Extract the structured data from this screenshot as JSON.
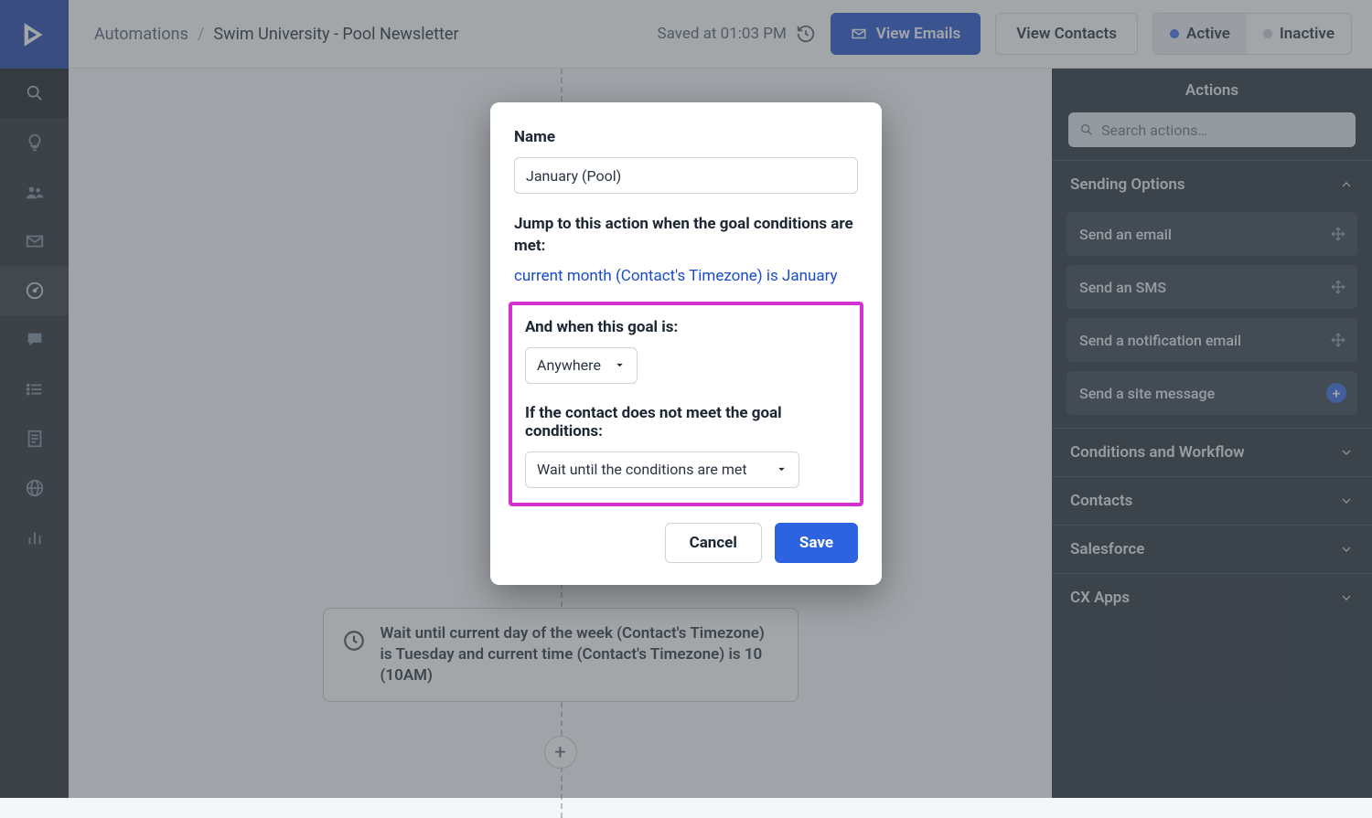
{
  "header": {
    "breadcrumb_root": "Automations",
    "breadcrumb_current": "Swim University - Pool Newsletter",
    "saved_text": "Saved at 01:03 PM",
    "view_emails": "View Emails",
    "view_contacts": "View Contacts",
    "toggle_active": "Active",
    "toggle_inactive": "Inactive"
  },
  "canvas": {
    "wait_text": "Wait until current day of the week (Contact's Timezone) is Tuesday and current time (Contact's Timezone) is 10 (10AM)"
  },
  "panel": {
    "title": "Actions",
    "search_placeholder": "Search actions…",
    "sections": {
      "sending": {
        "label": "Sending Options",
        "items": [
          "Send an email",
          "Send an SMS",
          "Send a notification email",
          "Send a site message"
        ]
      },
      "conditions": {
        "label": "Conditions and Workflow"
      },
      "contacts": {
        "label": "Contacts"
      },
      "salesforce": {
        "label": "Salesforce"
      },
      "cxapps": {
        "label": "CX Apps"
      }
    }
  },
  "modal": {
    "name_label": "Name",
    "name_value": "January (Pool)",
    "jump_text": "Jump to this action when the goal conditions are met:",
    "condition_link": "current month (Contact's Timezone) is January",
    "when_label": "And when this goal is:",
    "when_value": "Anywhere",
    "notmet_label": "If the contact does not meet the goal conditions:",
    "notmet_value": "Wait until the conditions are met",
    "cancel": "Cancel",
    "save": "Save"
  }
}
